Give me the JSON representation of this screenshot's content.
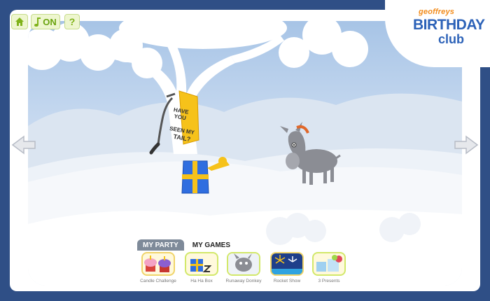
{
  "toolbar": {
    "home_icon": "home-icon",
    "music_icon": "music-note-icon",
    "music_label": "ON",
    "help_label": "?"
  },
  "logo": {
    "small": "geoffreys",
    "big": "BIRTHDAY",
    "club": "club"
  },
  "scene": {
    "poster_line1": "HAVE YOU",
    "poster_line2": "SEEN MY",
    "poster_line3": "TAIL?"
  },
  "navigation": {
    "prev_icon": "arrow-left-icon",
    "next_icon": "arrow-right-icon"
  },
  "tabs": [
    {
      "label": "MY PARTY",
      "active": false
    },
    {
      "label": "MY GAMES",
      "active": true
    }
  ],
  "games": [
    {
      "label": "Candle Challenge",
      "icon": "cupcakes-icon"
    },
    {
      "label": "Ha Ha Box",
      "icon": "ha-ha-box-icon"
    },
    {
      "label": "Runaway Donkey",
      "icon": "donkey-icon"
    },
    {
      "label": "Rocket Show",
      "icon": "fireworks-icon"
    },
    {
      "label": "3 Presents",
      "icon": "presents-icon"
    }
  ],
  "colors": {
    "background": "#2f4f86",
    "accent_green": "#7fb21a",
    "logo_blue": "#2c62b8",
    "logo_orange": "#f28c1c",
    "present_blue": "#2f6ee0",
    "ribbon_yellow": "#f6c21a"
  }
}
